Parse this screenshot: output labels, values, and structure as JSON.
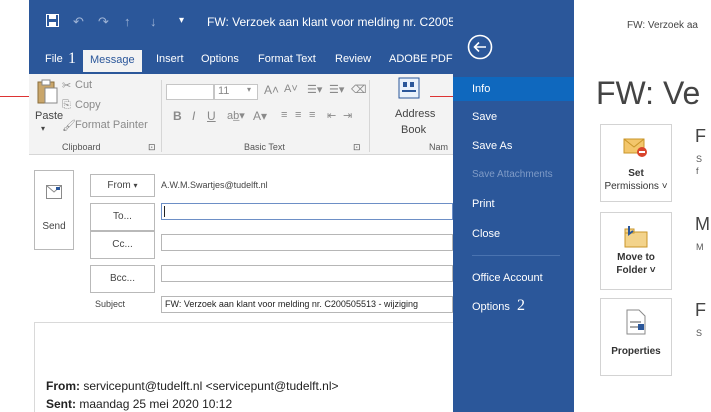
{
  "compose": {
    "window_title": "FW: Verzoek aan klant voor melding nr. C20050",
    "qat": {
      "undo_icon": "undo-icon",
      "redo_icon": "redo-icon",
      "up_icon": "up-arrow-icon",
      "down_icon": "down-arrow-icon",
      "customize": "ᘠ"
    },
    "tabs": [
      "File",
      "Message",
      "Insert",
      "Options",
      "Format Text",
      "Review",
      "ADOBE PDF"
    ],
    "callout_1": "1",
    "ribbon": {
      "clipboard": {
        "paste": "Paste",
        "cut": "Cut",
        "copy": "Copy",
        "format_painter": "Format Painter",
        "group": "Clipboard"
      },
      "basic_text": {
        "font_size": "11",
        "group": "Basic Text"
      },
      "names": {
        "address_book": "Address",
        "address_book2": "Book",
        "group": "Nam"
      }
    },
    "form": {
      "send": "Send",
      "from_label": "From",
      "from_value": "A.W.M.Swartjes@tudelft.nl",
      "to": "To...",
      "cc": "Cc...",
      "bcc": "Bcc...",
      "subject_label": "Subject",
      "subject_value": "FW: Verzoek aan klant voor melding nr. C200505513 - wijziging"
    },
    "body": {
      "from_label": "From:",
      "from_value": "servicepunt@tudelft.nl <servicepunt@tudelft.nl>",
      "sent_label": "Sent:",
      "sent_value": "maandag 25 mei 2020 10:12"
    }
  },
  "backstage": {
    "header_title": "FW: Verzoek aa",
    "big_title": "FW: Ve",
    "nav": [
      "Info",
      "Save",
      "Save As",
      "Save Attachments",
      "Print",
      "Close",
      "Office Account",
      "Options"
    ],
    "callout_2": "2",
    "cards": [
      {
        "label1": "Set",
        "label2": "Permissions ˅",
        "side_title": "F",
        "side_text": "S",
        "side_text2": "f"
      },
      {
        "label1": "Move to",
        "label2": "Folder ˅",
        "side_title": "M",
        "side_text": "M",
        "side_text2": ""
      },
      {
        "label1": "Properties",
        "label2": "",
        "side_title": "F",
        "side_text": "S",
        "side_text2": ""
      }
    ],
    "colors": {
      "accent": "#2b579a",
      "selected": "#0f68be"
    }
  }
}
